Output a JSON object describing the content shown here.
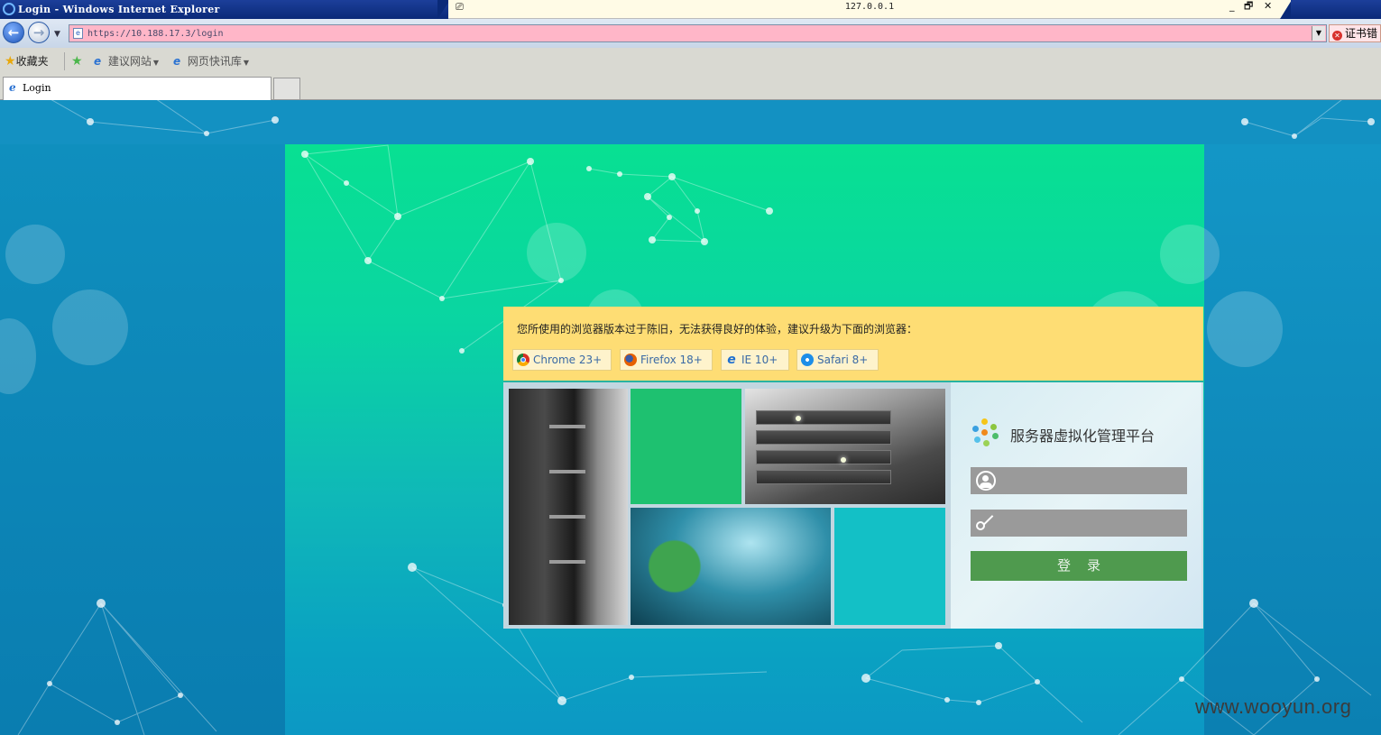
{
  "window": {
    "title": "Login - Windows Internet Explorer",
    "host": "127.0.0.1",
    "minimize": "_",
    "restore": "🗗",
    "close": "✕"
  },
  "navigation": {
    "back_glyph": "←",
    "forward_glyph": "→",
    "url": "https://10.188.17.3/login",
    "cert_error_label": "证书错"
  },
  "favorites_bar": {
    "favorites_label": "收藏夹",
    "items": [
      {
        "label": "建议网站",
        "icon": "ie-page-icon"
      },
      {
        "label": "网页快讯库",
        "icon": "ie-page-icon"
      }
    ]
  },
  "tabs": [
    {
      "label": "Login"
    }
  ],
  "notice": {
    "message": "您所使用的浏览器版本过于陈旧，无法获得良好的体验，建议升级为下面的浏览器：",
    "browsers": [
      {
        "label": "Chrome 23+",
        "icon": "chrome-icon"
      },
      {
        "label": "Firefox 18+",
        "icon": "firefox-icon"
      },
      {
        "label": "IE 10+",
        "icon": "ie-icon"
      },
      {
        "label": "Safari 8+",
        "icon": "safari-icon"
      }
    ]
  },
  "login": {
    "platform_title": "服务器虚拟化管理平台",
    "username_value": "",
    "password_value": "",
    "submit_label": "登录"
  },
  "watermark": "www.wooyun.org",
  "colors": {
    "notice_bg": "#fedd74",
    "login_button": "#4f9a4e",
    "field_bg": "#9a9a9a",
    "stage_top": "#08e092",
    "page_bg": "#0d87bb"
  }
}
